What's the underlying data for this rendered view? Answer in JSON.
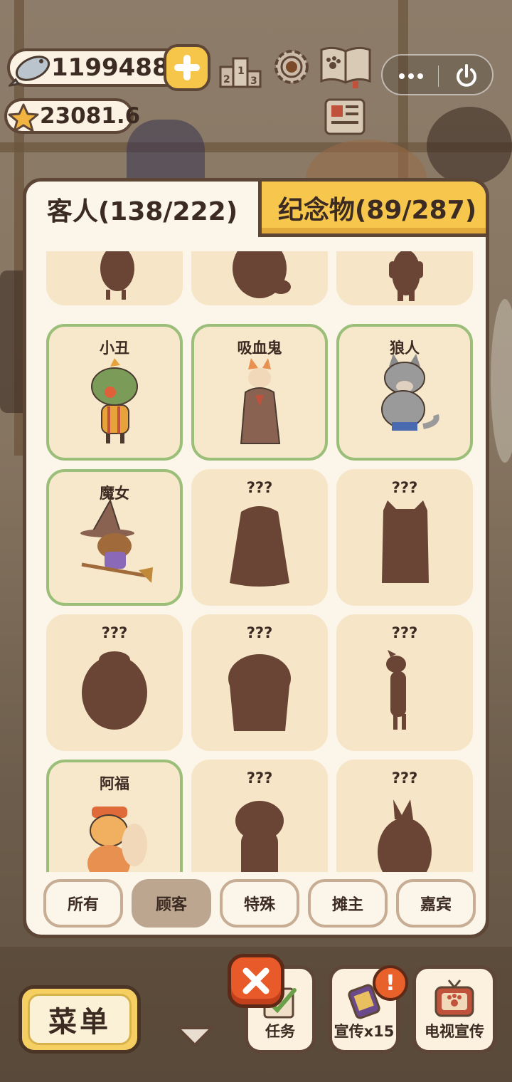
{
  "currency": {
    "fish_amount": "11994880",
    "star_amount": "23081.6"
  },
  "hud_icons": [
    "ranking-icon",
    "settings-gear-icon",
    "paw-book-icon",
    "news-card-icon"
  ],
  "miniprogram": {
    "menu_icon": "more-dots-icon",
    "exit_icon": "power-icon"
  },
  "tabs": [
    {
      "label": "客人(138/222)",
      "active": true
    },
    {
      "label": "纪念物(89/287)",
      "active": false
    }
  ],
  "cards": [
    {
      "name": "",
      "unlocked": false,
      "icon": "silhouette-bird"
    },
    {
      "name": "",
      "unlocked": false,
      "icon": "silhouette-bear"
    },
    {
      "name": "",
      "unlocked": false,
      "icon": "silhouette-figure"
    },
    {
      "name": "小丑",
      "unlocked": true,
      "icon": "clown-frog-icon"
    },
    {
      "name": "吸血鬼",
      "unlocked": true,
      "icon": "vampire-fox-icon"
    },
    {
      "name": "狼人",
      "unlocked": true,
      "icon": "werewolf-icon"
    },
    {
      "name": "魔女",
      "unlocked": true,
      "icon": "witch-on-broom-icon"
    },
    {
      "name": "???",
      "unlocked": false,
      "icon": "silhouette-longhair"
    },
    {
      "name": "???",
      "unlocked": false,
      "icon": "silhouette-cat"
    },
    {
      "name": "???",
      "unlocked": false,
      "icon": "silhouette-round"
    },
    {
      "name": "???",
      "unlocked": false,
      "icon": "silhouette-fluffy"
    },
    {
      "name": "???",
      "unlocked": false,
      "icon": "silhouette-dog"
    },
    {
      "name": "阿福",
      "unlocked": true,
      "icon": "afu-squirrel-icon"
    },
    {
      "name": "???",
      "unlocked": false,
      "icon": "silhouette-kid"
    },
    {
      "name": "???",
      "unlocked": false,
      "icon": "silhouette-rabbit"
    }
  ],
  "filters": [
    {
      "label": "所有",
      "active": false
    },
    {
      "label": "顾客",
      "active": true
    },
    {
      "label": "特殊",
      "active": false
    },
    {
      "label": "摊主",
      "active": false
    },
    {
      "label": "嘉宾",
      "active": false
    }
  ],
  "bottom": {
    "menu_label": "菜单",
    "task_label": "任务",
    "promo_label": "宣传x15",
    "tv_label": "电视宣传",
    "alert_symbol": "!"
  },
  "colors": {
    "panel_border": "#5e4636",
    "tab_active_bg": "#fbf5ea",
    "tab_inactive_bg": "#f6c74c",
    "unlocked_border": "#9bbf78",
    "silhouette": "#6a4535",
    "close_button": "#e85a2a"
  }
}
